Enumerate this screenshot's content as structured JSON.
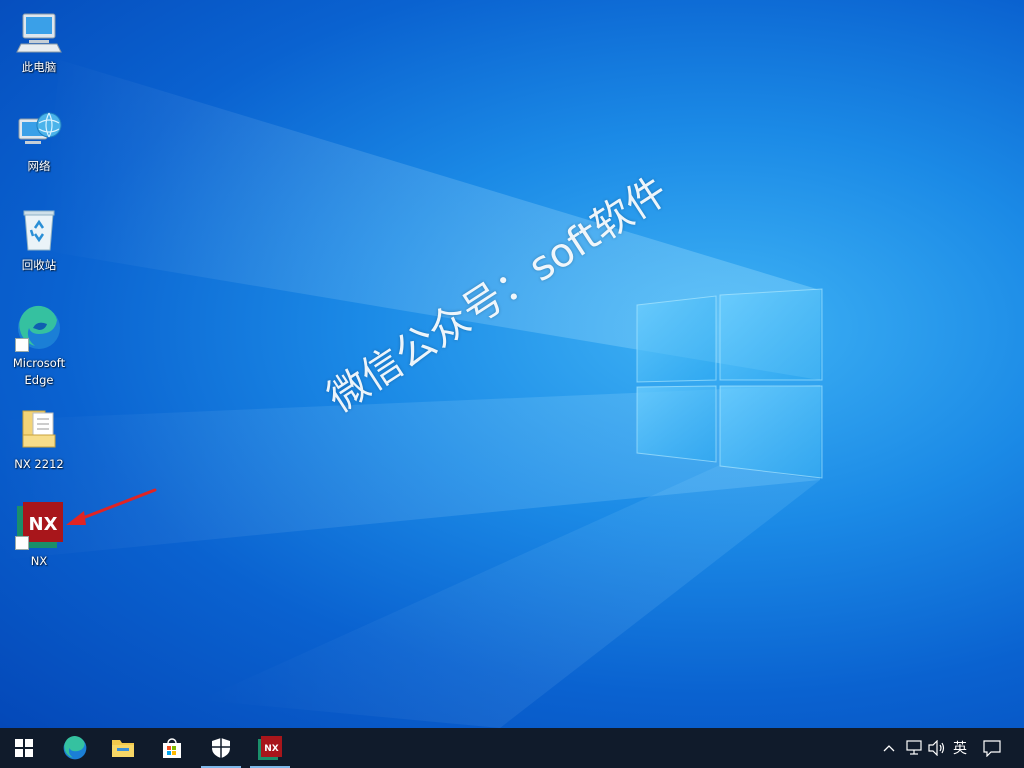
{
  "desktop": {
    "icons": [
      {
        "label": "此电脑",
        "icon": "computer-icon"
      },
      {
        "label": "网络",
        "icon": "network-icon"
      },
      {
        "label": "回收站",
        "icon": "recycle-bin-icon"
      },
      {
        "label": "Microsoft Edge",
        "icon": "edge-icon"
      },
      {
        "label": "NX 2212",
        "icon": "folder-icon"
      },
      {
        "label": "NX",
        "icon": "nx-app-icon"
      }
    ],
    "watermark": "微信公众号：soft软件",
    "nx_logo_text": "NX"
  },
  "taskbar": {
    "items": [
      {
        "name": "start",
        "icon": "windows-start-icon"
      },
      {
        "name": "edge",
        "icon": "edge-icon"
      },
      {
        "name": "file-explorer",
        "icon": "folder-icon"
      },
      {
        "name": "microsoft-store",
        "icon": "store-icon"
      },
      {
        "name": "windows-security",
        "icon": "shield-icon"
      },
      {
        "name": "nx",
        "icon": "nx-app-icon"
      }
    ],
    "nx_logo_text": "NX",
    "ime_label": "英"
  },
  "colors": {
    "taskbar_bg": "#101b2b",
    "nx_red": "#a8161b",
    "nx_green": "#1a8f6a",
    "arrow_red": "#e02424"
  }
}
